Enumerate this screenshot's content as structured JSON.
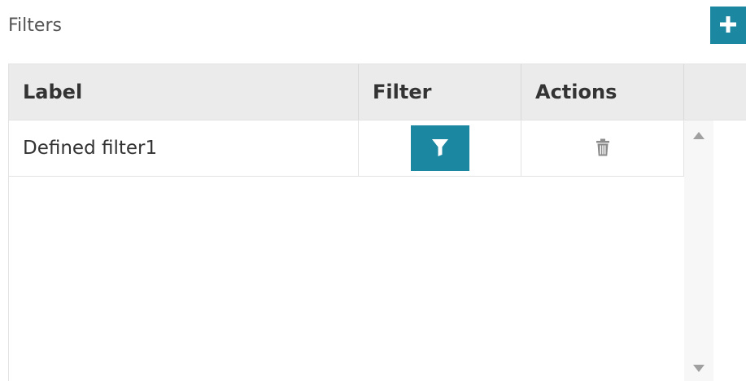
{
  "section": {
    "title": "Filters"
  },
  "toolbar": {
    "add_icon": "plus-icon"
  },
  "table": {
    "columns": [
      "Label",
      "Filter",
      "Actions"
    ],
    "rows": [
      {
        "label": "Defined filter1",
        "filter_icon": "funnel-icon",
        "action_icon": "trash-icon"
      }
    ]
  },
  "colors": {
    "accent": "#1b87a0",
    "header_bg": "#ebebeb",
    "border": "#e3e3e3",
    "text": "#333333",
    "icon_gray": "#8c8c8c"
  }
}
